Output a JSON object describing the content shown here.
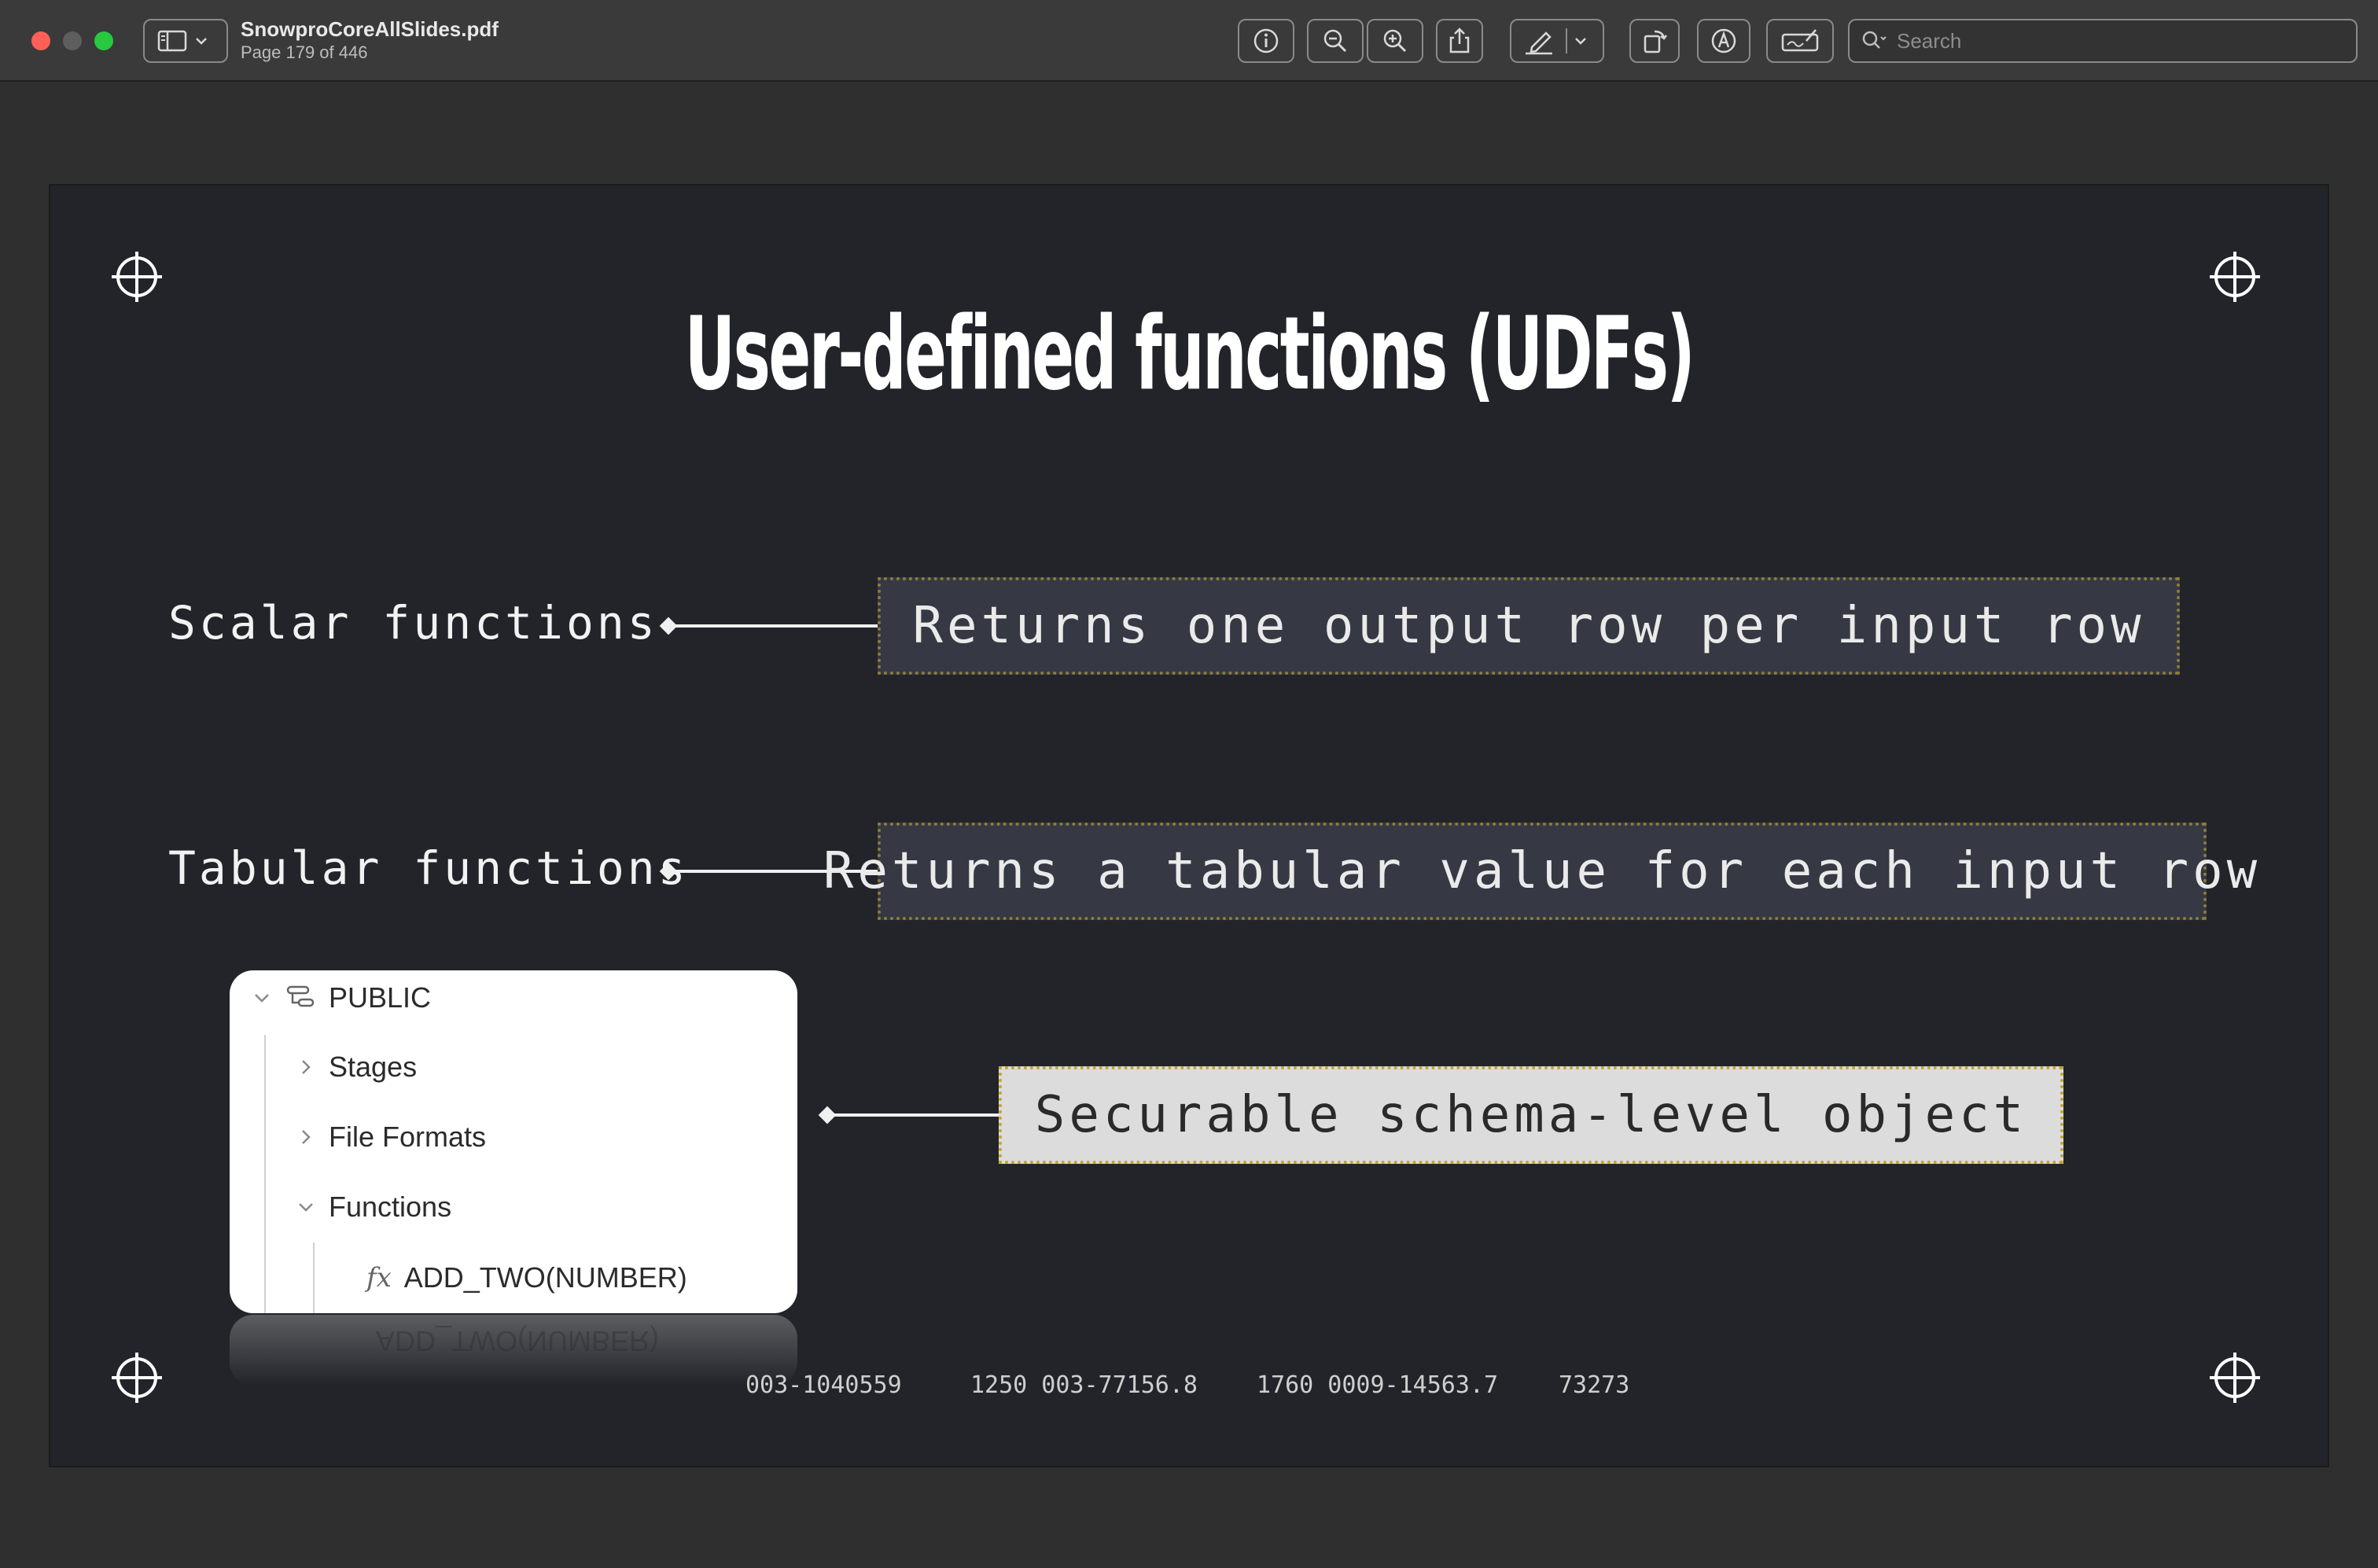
{
  "window": {
    "document_title": "SnowproCoreAllSlides.pdf",
    "page_status": "Page 179 of 446"
  },
  "toolbar": {
    "search_placeholder": "Search",
    "icons": [
      "sidebar-toggle-icon",
      "chevron-down-icon",
      "info-icon",
      "zoom-out-icon",
      "zoom-in-icon",
      "share-icon",
      "markup-pen-icon",
      "chevron-down-icon",
      "rotate-icon",
      "markup-circle-icon",
      "signature-icon",
      "search-icon"
    ]
  },
  "slide": {
    "title": "User-defined functions (UDFs)",
    "rows": [
      {
        "label": "Scalar functions",
        "description": "Returns one output row per input row"
      },
      {
        "label": "Tabular functions",
        "description": "Returns a tabular value for each input row"
      }
    ],
    "schema_object_description": "Securable schema-level object",
    "tree": {
      "root": "PUBLIC",
      "items": [
        "Stages",
        "File Formats",
        "Functions"
      ],
      "function_item": "ADD_TWO(NUMBER)",
      "function_icon_text": "fx"
    },
    "footer": {
      "code1": "003-1040559",
      "code2": "1250 003-77156.8",
      "code3": "1760 0009-14563.7",
      "code4": "73273"
    }
  },
  "colors": {
    "slide_background": "#23242a",
    "box_border": "#8b7d3a",
    "highlight_box_border": "#c2a629",
    "highlight_box_fill": "#dcdcdc"
  }
}
